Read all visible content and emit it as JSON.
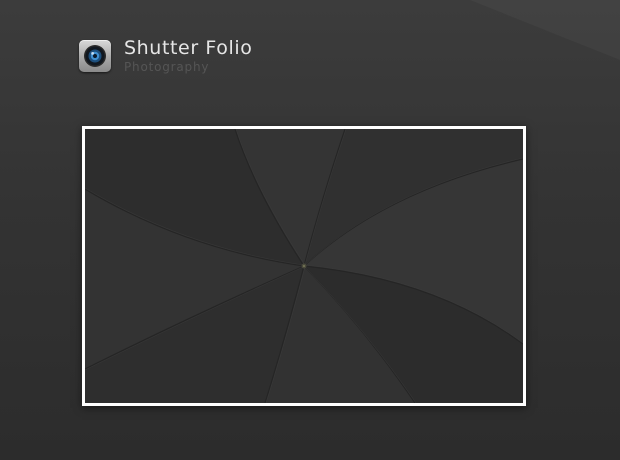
{
  "brand": {
    "title": "Shutter Folio",
    "subtitle": "Photography",
    "logo_icon": "camera-lens-icon"
  },
  "viewer": {
    "placeholder_icon": "aperture-shutter-icon",
    "frame_color": "#ffffff"
  },
  "colors": {
    "background": "#333333",
    "title_text": "#e6e6e6",
    "subtitle_text": "#555555"
  }
}
